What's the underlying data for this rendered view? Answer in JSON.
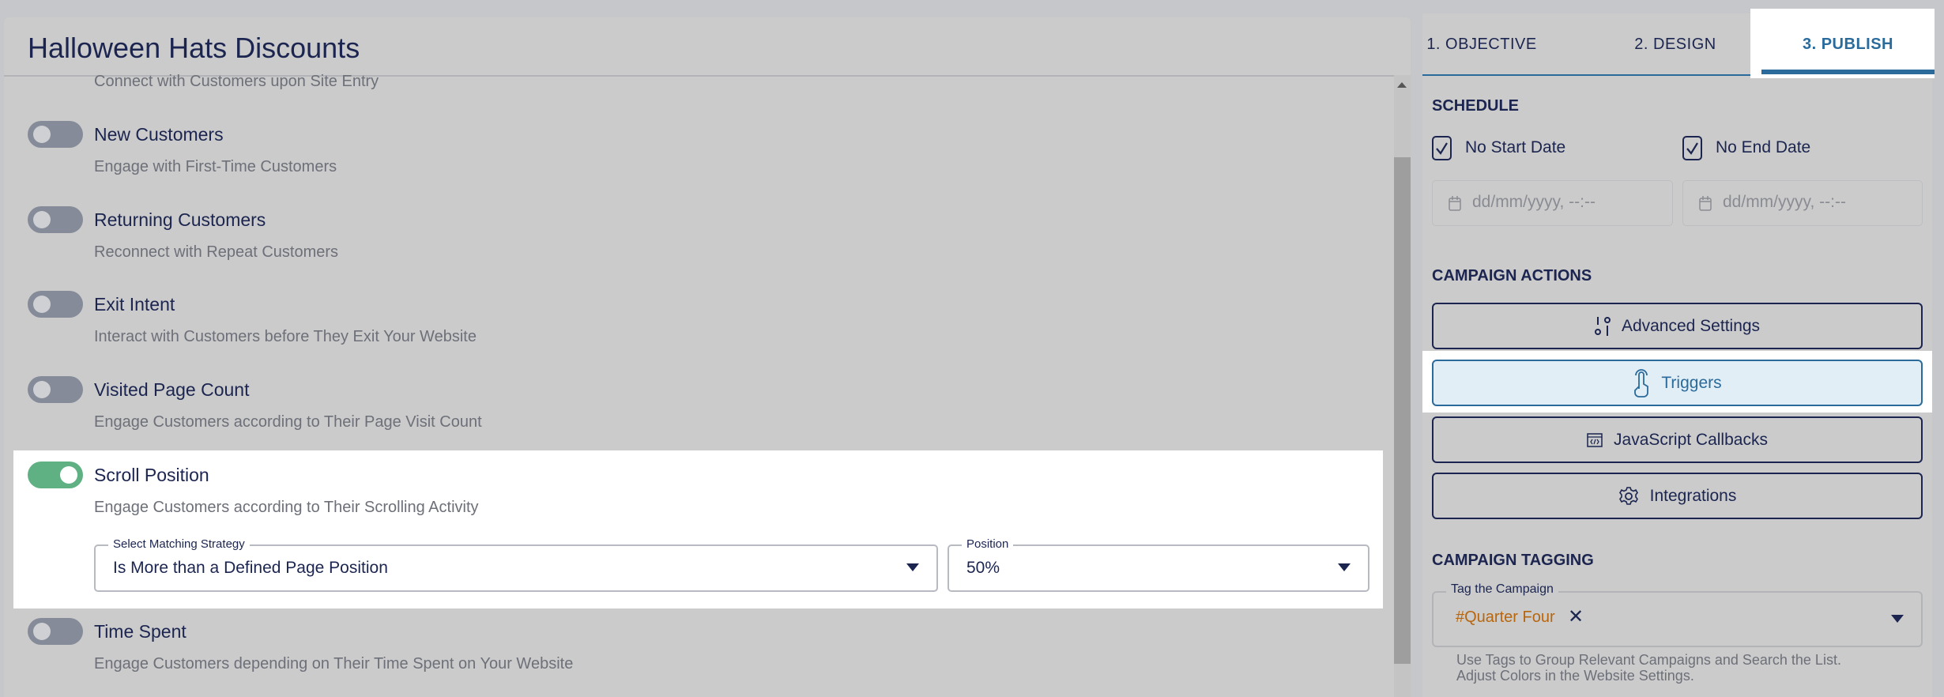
{
  "header": {
    "title": "Halloween Hats Discounts"
  },
  "triggers": [
    {
      "title": "",
      "desc": "Connect with Customers upon Site Entry",
      "enabled": false
    },
    {
      "title": "New Customers",
      "desc": "Engage with First-Time Customers",
      "enabled": false
    },
    {
      "title": "Returning Customers",
      "desc": "Reconnect with Repeat Customers",
      "enabled": false
    },
    {
      "title": "Exit Intent",
      "desc": "Interact with Customers before They Exit Your Website",
      "enabled": false
    },
    {
      "title": "Visited Page Count",
      "desc": "Engage Customers according to Their Page Visit Count",
      "enabled": false
    },
    {
      "title": "Scroll Position",
      "desc": "Engage Customers according to Their Scrolling Activity",
      "enabled": true
    },
    {
      "title": "Time Spent",
      "desc": "Engage Customers depending on Their Time Spent on Your Website",
      "enabled": false
    }
  ],
  "scroll": {
    "strategy_label": "Select Matching Strategy",
    "strategy_value": "Is More than a Defined Page Position",
    "position_label": "Position",
    "position_value": "50%"
  },
  "tabs": [
    {
      "label": "1. OBJECTIVE"
    },
    {
      "label": "2. DESIGN"
    },
    {
      "label": "3. PUBLISH",
      "active": true
    }
  ],
  "schedule": {
    "title": "SCHEDULE",
    "no_start": "No Start Date",
    "no_end": "No End Date",
    "start_placeholder": "dd/mm/yyyy, --:--",
    "end_placeholder": "dd/mm/yyyy, --:--"
  },
  "actions": {
    "title": "CAMPAIGN ACTIONS",
    "advanced": "Advanced Settings",
    "triggers": "Triggers",
    "js": "JavaScript Callbacks",
    "integrations": "Integrations"
  },
  "tagging": {
    "title": "CAMPAIGN TAGGING",
    "label": "Tag the Campaign",
    "tag": "#Quarter Four",
    "help1": "Use Tags to Group Relevant Campaigns and Search the List.",
    "help2": "Adjust Colors in the Website Settings."
  },
  "colors": {
    "accent": "#2a6b9c",
    "toggle_on": "#5fb083",
    "tag": "#b8660e",
    "text": "#1b2550"
  }
}
